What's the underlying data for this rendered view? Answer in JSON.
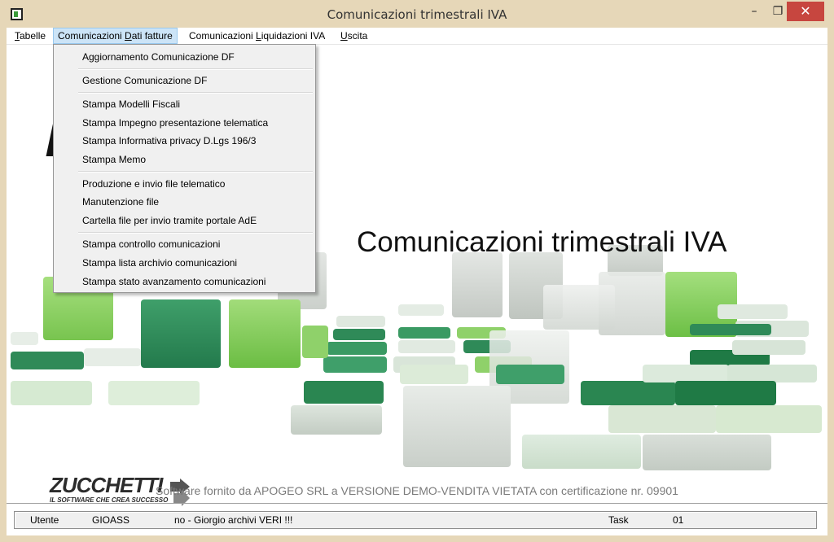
{
  "window": {
    "title": "Comunicazioni trimestrali IVA",
    "icon": "app-window-icon",
    "controls": {
      "minimize": "–",
      "restore": "❐",
      "close": "✕"
    }
  },
  "menubar": {
    "items": [
      {
        "pre": "",
        "accel": "T",
        "post": "abelle"
      },
      {
        "pre": "Comunicazioni ",
        "accel": "D",
        "post": "ati fatture"
      },
      {
        "pre": "Comunicazioni ",
        "accel": "L",
        "post": "iquidazioni IVA"
      },
      {
        "pre": "",
        "accel": "U",
        "post": "scita"
      }
    ]
  },
  "dropdown": {
    "items": [
      "Aggiornamento Comunicazione DF",
      "Gestione Comunicazione DF",
      "Stampa Modelli Fiscali",
      "Stampa Impegno presentazione telematica",
      "Stampa Informativa privacy D.Lgs 196/3",
      "Stampa Memo",
      "Produzione e invio file telematico",
      "Manutenzione file",
      "Cartella file per invio tramite portale AdE",
      "Stampa controllo comunicazioni",
      "Stampa lista archivio comunicazioni",
      "Stampa stato avanzamento comunicazioni"
    ]
  },
  "splash": {
    "title": "Comunicazioni trimestrali IVA",
    "logo_text": "ZUCCHETTI",
    "logo_tagline": "IL SOFTWARE CHE CREA SUCCESSO",
    "footer": "Software fornito da APOGEO SRL a VERSIONE DEMO-VENDITA VIETATA con certificazione nr. 09901"
  },
  "statusbar": {
    "user_label": "Utente",
    "user_value": "GIOASS",
    "archive": "no - Giorgio archivi VERI !!!",
    "task_label": "Task",
    "task_value": "01"
  },
  "colors": {
    "frame": "#e6d7b8",
    "close_button": "#c7463f",
    "menu_highlight": "#cce4f7",
    "dark_green": "#2e8b57",
    "light_green": "#8fd16a",
    "pale_green": "#d5ecd0",
    "gray_block": "#c9cfc9"
  }
}
